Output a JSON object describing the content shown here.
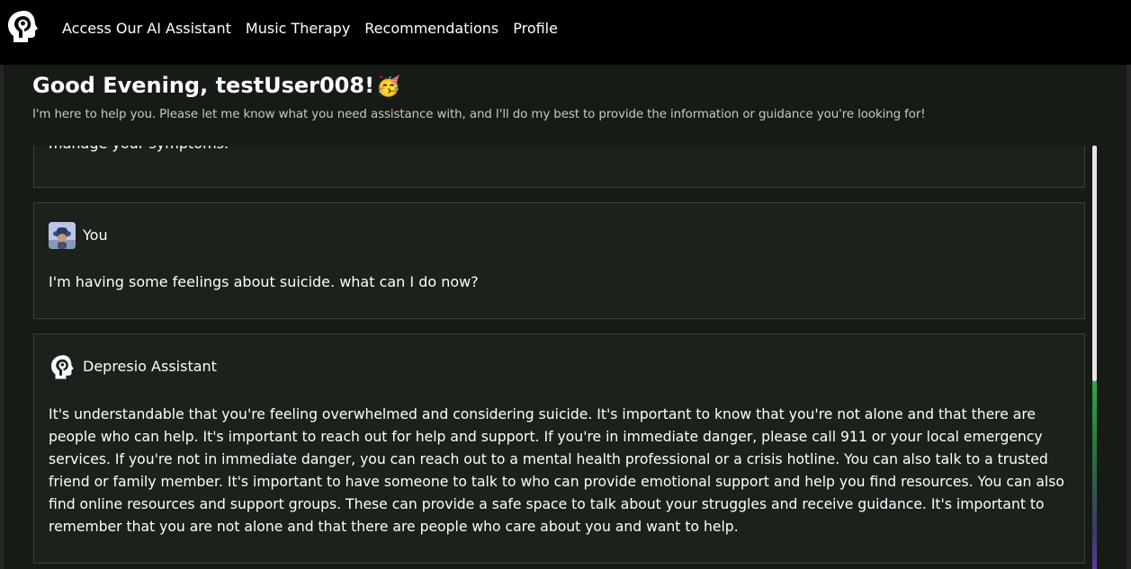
{
  "nav": {
    "logo_icon": "head-heart-logo-icon",
    "items": [
      {
        "label": "Access Our AI Assistant"
      },
      {
        "label": "Music Therapy"
      },
      {
        "label": "Recommendations"
      },
      {
        "label": "Profile"
      }
    ]
  },
  "header": {
    "greeting": "Good Evening, testUser008!",
    "greeting_emoji": "🥳",
    "subtitle": "I'm here to help you. Please let me know what you need assistance with, and I'll do my best to provide the information or guidance you're looking for!"
  },
  "chat": {
    "messages": [
      {
        "sender": "",
        "text": "manage your symptoms."
      },
      {
        "sender": "You",
        "avatar_icon": "user-avatar",
        "text": "I'm having some feelings about suicide. what can I do now?"
      },
      {
        "sender": "Depresio Assistant",
        "avatar_icon": "assistant-logo-icon",
        "text": "It's understandable that you're feeling overwhelmed and considering suicide. It's important to know that you're not alone and that there are people who can help. It's important to reach out for help and support. If you're in immediate danger, please call 911 or your local emergency services. If you're not in immediate danger, you can reach out to a mental health professional or a crisis hotline. You can also talk to a trusted friend or family member. It's important to have someone to talk to who can provide emotional support and help you find resources. You can also find online resources and support groups. These can provide a safe space to talk about your struggles and receive guidance. It's important to remember that you are not alone and that there are people who care about you and want to help."
      }
    ]
  },
  "colors": {
    "topbar_bg": "#000000",
    "page_bg": "#161b16",
    "card_bg": "#1a221b",
    "card_border": "#3b433b",
    "scrollbar_accent": "#2fa74a"
  }
}
